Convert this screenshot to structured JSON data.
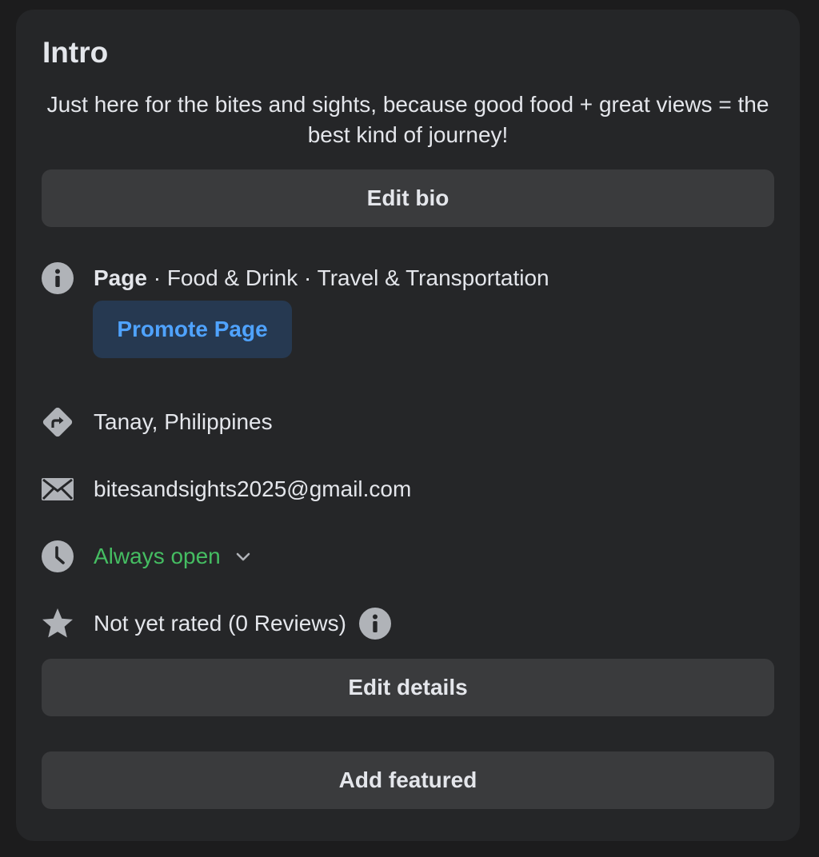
{
  "intro": {
    "title": "Intro",
    "bio": "Just here for the bites and sights, because good food + great views = the best kind of journey!",
    "edit_bio_label": "Edit bio",
    "category": {
      "type_label": "Page",
      "separator_1": " · ",
      "cat_1": "Food & Drink",
      "separator_2": " · ",
      "cat_2": "Travel & Transportation"
    },
    "promote_label": "Promote Page",
    "location": "Tanay, Philippines",
    "email": "bitesandsights2025@gmail.com",
    "hours": "Always open",
    "rating": "Not yet rated (0 Reviews)",
    "edit_details_label": "Edit details",
    "add_featured_label": "Add featured"
  },
  "colors": {
    "background": "#1c1c1d",
    "card": "#252628",
    "button": "#3a3b3d",
    "promote_bg": "#263951",
    "promote_text": "#4fa3ff",
    "open_green": "#45bd62",
    "icon_gray": "#b0b3b8"
  },
  "icons": {
    "category": "info-icon",
    "location": "directions-icon",
    "email": "envelope-icon",
    "hours": "clock-icon",
    "rating": "star-icon",
    "hours_toggle": "chevron-down-icon",
    "rating_info": "info-icon"
  }
}
